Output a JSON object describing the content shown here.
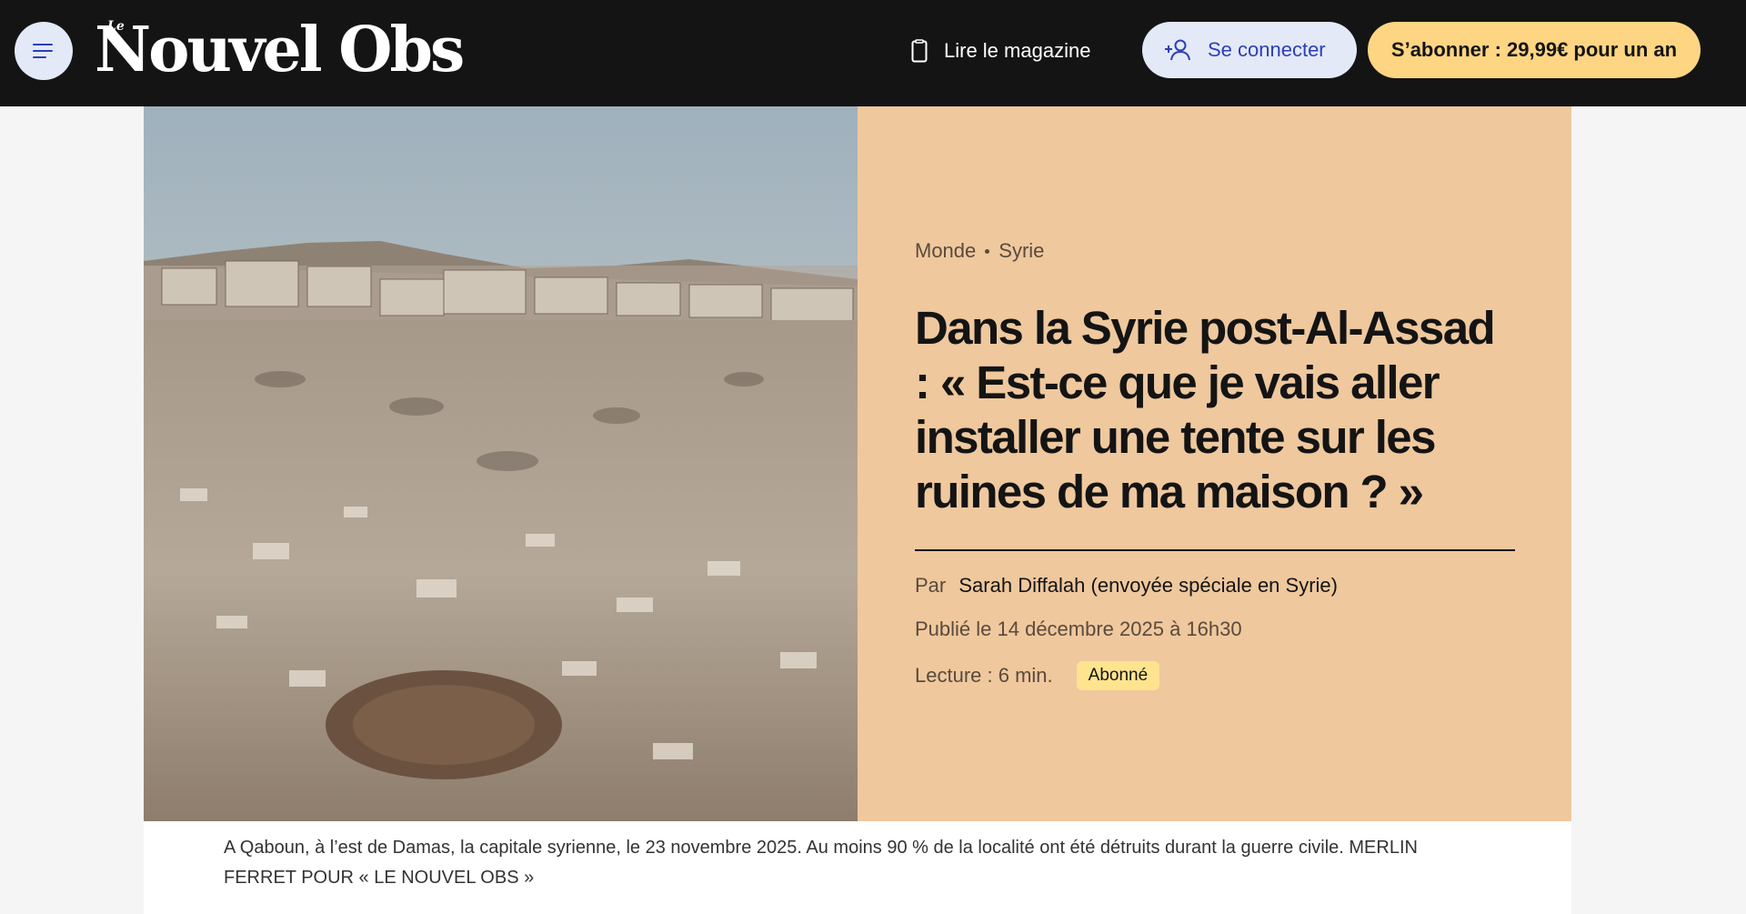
{
  "header": {
    "logo_small": "Le",
    "logo_main": "Nouvel Obs",
    "magazine_label": "Lire le magazine",
    "login_label": "Se connecter",
    "subscribe_label": "S’abonner : 29,99€ pour un an"
  },
  "article": {
    "breadcrumb": [
      "Monde",
      "Syrie"
    ],
    "headline": "Dans la Syrie post-Al-Assad : « Est-ce que je vais aller installer une tente sur les ruines de ma maison ? »",
    "byline_prefix": "Par",
    "author": "Sarah Diffalah (envoyée spéciale en Syrie)",
    "published": "Publié le 14 décembre 2025 à 16h30",
    "read_time": "Lecture : 6 min.",
    "badge": "Abonné",
    "caption": "A Qaboun, à l’est de Damas, la capitale syrienne, le 23 novembre 2025. Au moins 90 % de la localité ont été détruits durant la guerre civile.  MERLIN FERRET POUR « LE NOUVEL OBS »"
  },
  "colors": {
    "topbar": "#141414",
    "hero_background": "#efc89e",
    "login_background": "#e4e9f8",
    "login_text": "#2b3fb8",
    "subscribe_background": "#fed582",
    "badge_background": "#fee48e"
  },
  "icons": {
    "menu": "menu-icon",
    "magazine": "tablet-icon",
    "login": "user-add-icon"
  }
}
